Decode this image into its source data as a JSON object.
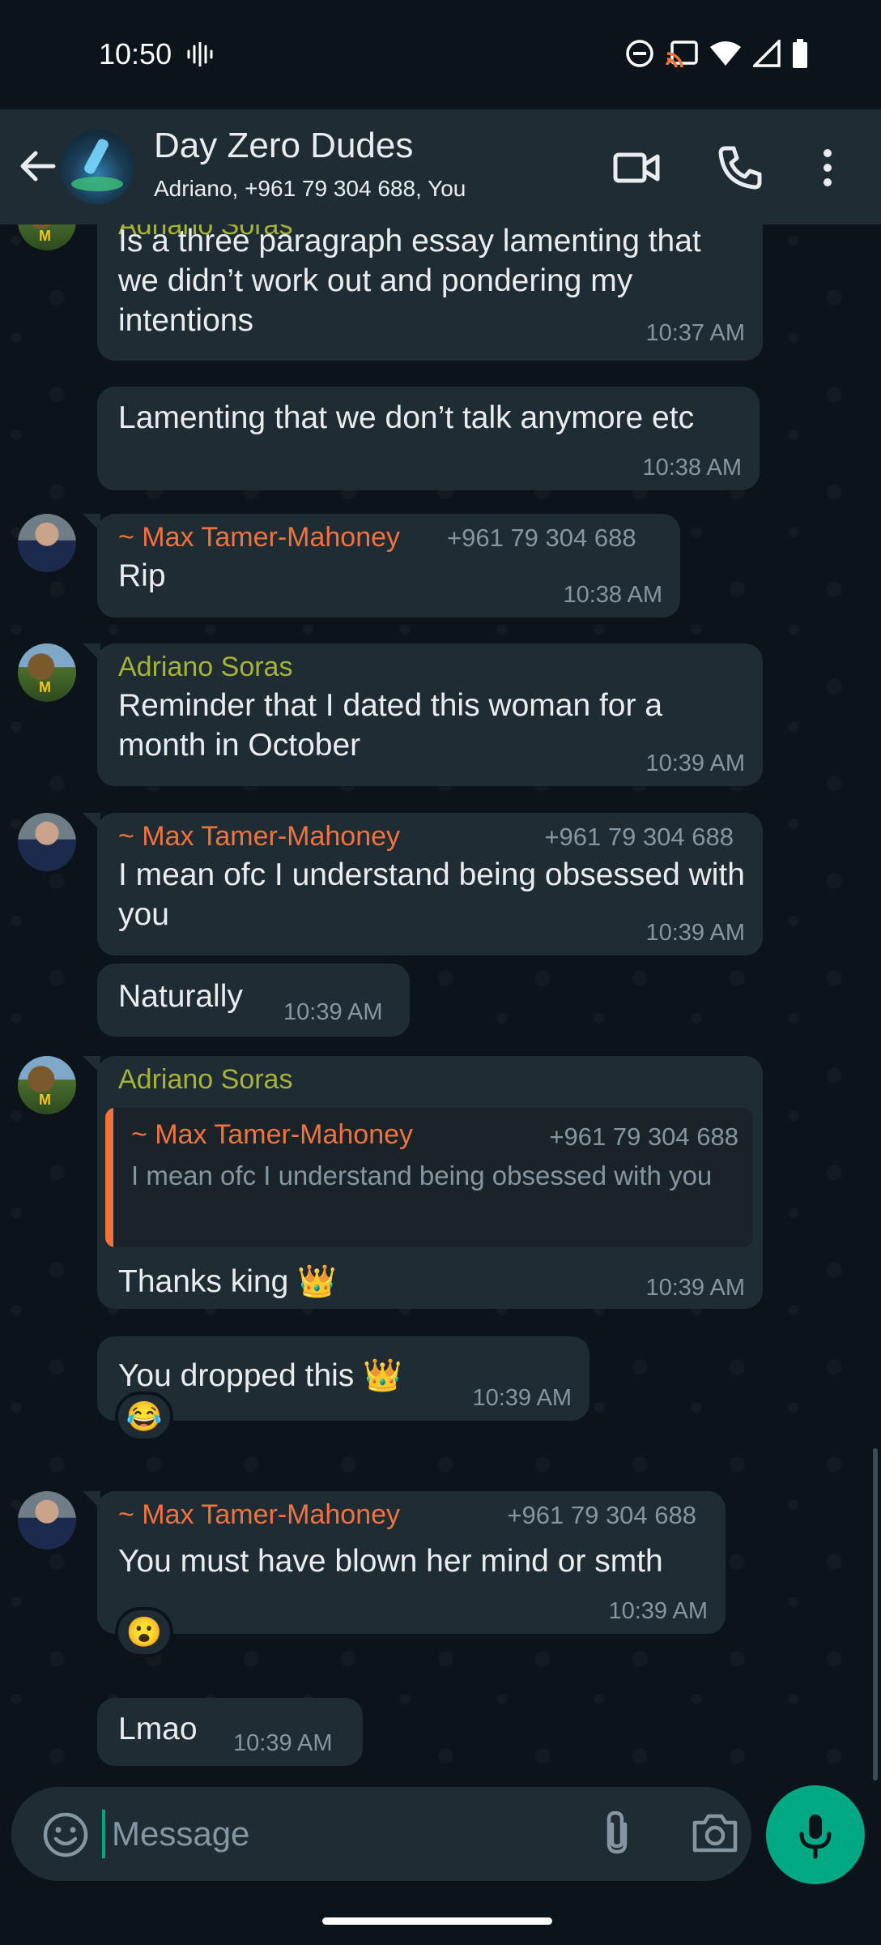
{
  "status_bar": {
    "time": "10:50"
  },
  "header": {
    "title": "Day Zero Dudes",
    "subtitle": "Adriano, +961 79 304 688, You"
  },
  "messages": [
    {
      "sender": "Adriano Soras",
      "text": "Is a three paragraph essay lamenting that we didn’t work out and pondering my intentions",
      "time": "10:37 AM"
    },
    {
      "text": "Lamenting that we don’t talk anymore etc",
      "time": "10:38 AM"
    },
    {
      "sender": "~ Max Tamer-Mahoney",
      "phone": "+961 79 304 688",
      "text": "Rip",
      "time": "10:38 AM"
    },
    {
      "sender": "Adriano Soras",
      "text": "Reminder that I dated this woman for a month in October",
      "time": "10:39 AM"
    },
    {
      "sender": "~ Max Tamer-Mahoney",
      "phone": "+961 79 304 688",
      "text": "I mean ofc I understand being obsessed with you",
      "time": "10:39 AM"
    },
    {
      "text": "Naturally",
      "time": "10:39 AM"
    },
    {
      "sender": "Adriano Soras",
      "quote_sender": "~ Max Tamer-Mahoney",
      "quote_phone": "+961 79 304 688",
      "quote_text": "I mean ofc I understand being obsessed with you",
      "text": "Thanks king 👑",
      "time": "10:39 AM"
    },
    {
      "text": "You dropped this 👑",
      "time": "10:39 AM",
      "reaction": "😂"
    },
    {
      "sender": "~ Max Tamer-Mahoney",
      "phone": "+961 79 304 688",
      "text": "You must have blown her mind or smth",
      "time": "10:39 AM",
      "reaction": "😮"
    },
    {
      "text": "Lmao",
      "time": "10:39 AM"
    }
  ],
  "input": {
    "placeholder": "Message"
  },
  "colors": {
    "background": "#0b141a",
    "header": "#1f2c34",
    "bubble": "#202c33",
    "accent": "#00a884",
    "sender_max": "#f0733e",
    "sender_adriano": "#a5b337"
  },
  "icons": [
    "back-arrow-icon",
    "video-call-icon",
    "phone-icon",
    "more-vert-icon",
    "emoji-icon",
    "attach-icon",
    "camera-icon",
    "mic-icon"
  ]
}
